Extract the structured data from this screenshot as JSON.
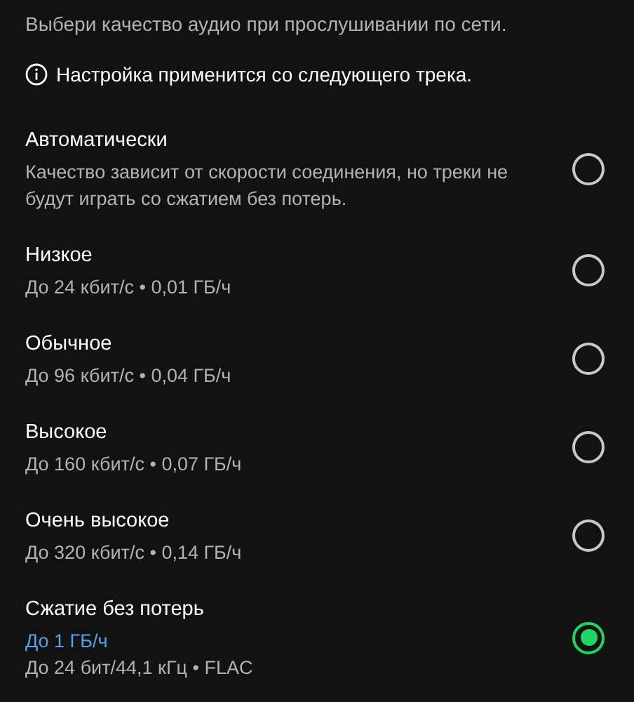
{
  "intro": "Выбери качество аудио при прослушивании по сети.",
  "notice": {
    "text": "Настройка применится со следующего трека."
  },
  "options": [
    {
      "title": "Автоматически",
      "lines": [
        {
          "kind": "normal",
          "text": "Качество зависит от скорости соединения, но треки не будут играть со сжатием без потерь."
        }
      ],
      "selected": false
    },
    {
      "title": "Низкое",
      "lines": [
        {
          "kind": "normal",
          "text": "До 24 кбит/с • 0,01 ГБ/ч"
        }
      ],
      "selected": false
    },
    {
      "title": "Обычное",
      "lines": [
        {
          "kind": "normal",
          "text": "До 96 кбит/с • 0,04 ГБ/ч"
        }
      ],
      "selected": false
    },
    {
      "title": "Высокое",
      "lines": [
        {
          "kind": "normal",
          "text": "До 160 кбит/с • 0,07 ГБ/ч"
        }
      ],
      "selected": false
    },
    {
      "title": "Очень высокое",
      "lines": [
        {
          "kind": "normal",
          "text": "До 320 кбит/с • 0,14 ГБ/ч"
        }
      ],
      "selected": false
    },
    {
      "title": "Сжатие без потерь",
      "lines": [
        {
          "kind": "highlight",
          "text": "До 1 ГБ/ч"
        },
        {
          "kind": "normal",
          "text": "До 24 бит/44,1 кГц • FLAC"
        }
      ],
      "selected": true
    }
  ]
}
